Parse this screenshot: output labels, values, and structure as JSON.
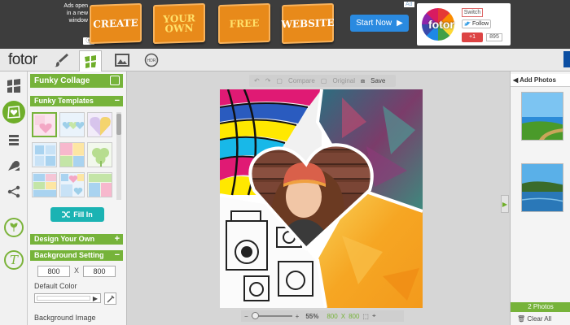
{
  "ad": {
    "note": "Ads open in a new window",
    "close": "ⓧ",
    "tiles": [
      "CREATE",
      "YOUR OWN",
      "FREE",
      "WEBSITE"
    ],
    "start_button": "Start Now",
    "badge": "Ad",
    "card": {
      "brand": "fotor",
      "switch": "Switch",
      "follow": "Follow",
      "gplus": "+1",
      "gplus_count": "895"
    }
  },
  "toolbar": {
    "logo": "fotor",
    "hdr_label": "HDR"
  },
  "panel": {
    "title": "Funky Collage",
    "templates_section": "Funky Templates",
    "fill_in": "Fill In",
    "design_section": "Design Your Own",
    "background_section": "Background Setting",
    "width": "800",
    "height": "800",
    "x": "X",
    "default_color": "Default Color",
    "background_image": "Background Image",
    "minus": "−",
    "plus": "+"
  },
  "canvas": {
    "compare": "Compare",
    "original": "Original",
    "save": "Save",
    "zoom": "55%",
    "size_w": "800",
    "size_x": "X",
    "size_h": "800",
    "zoom_minus": "−",
    "zoom_plus": "+"
  },
  "right": {
    "add_photos": "Add Photos",
    "count": "2 Photos",
    "clear_all": "Clear All"
  }
}
